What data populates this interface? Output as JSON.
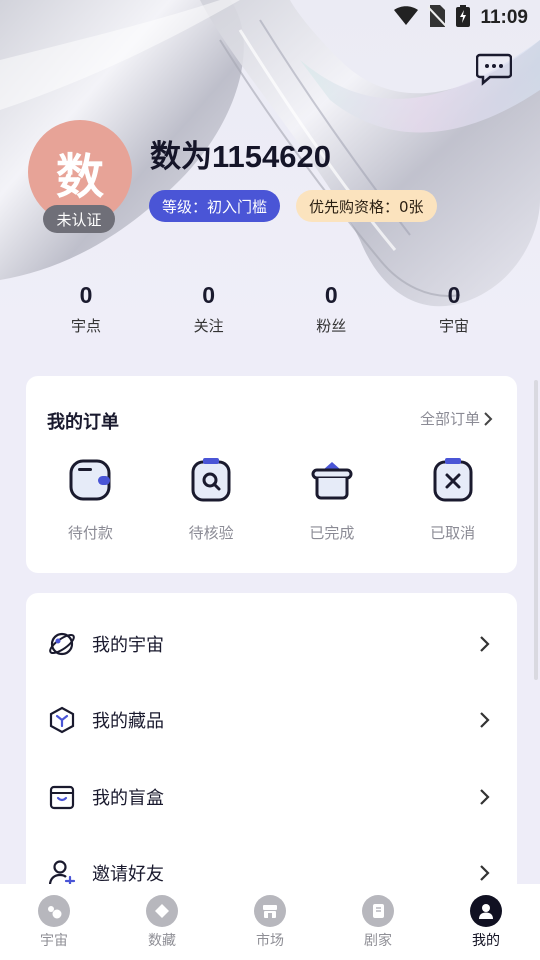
{
  "status_bar": {
    "time": "11:09"
  },
  "profile": {
    "avatar_char": "数",
    "verify_status": "未认证",
    "username": "数为1154620",
    "level_badge": "等级：初入门槛",
    "priority_badge": "优先购资格：0张"
  },
  "stats": [
    {
      "value": "0",
      "label": "宇点"
    },
    {
      "value": "0",
      "label": "关注"
    },
    {
      "value": "0",
      "label": "粉丝"
    },
    {
      "value": "0",
      "label": "宇宙"
    }
  ],
  "orders": {
    "title": "我的订单",
    "all_link": "全部订单",
    "items": [
      {
        "label": "待付款",
        "icon": "wallet-icon"
      },
      {
        "label": "待核验",
        "icon": "clipboard-search-icon"
      },
      {
        "label": "已完成",
        "icon": "basket-icon"
      },
      {
        "label": "已取消",
        "icon": "clipboard-x-icon"
      }
    ]
  },
  "menu": [
    {
      "label": "我的宇宙",
      "icon": "planet-icon"
    },
    {
      "label": "我的藏品",
      "icon": "hexagon-y-icon"
    },
    {
      "label": "我的盲盒",
      "icon": "box-icon"
    },
    {
      "label": "邀请好友",
      "icon": "user-plus-icon"
    }
  ],
  "tabs": [
    {
      "label": "宇宙",
      "active": false
    },
    {
      "label": "数藏",
      "active": false
    },
    {
      "label": "市场",
      "active": false
    },
    {
      "label": "剧家",
      "active": false
    },
    {
      "label": "我的",
      "active": true
    }
  ],
  "colors": {
    "accent": "#4a55d6",
    "priority_bg": "#fbe3be",
    "avatar_bg": "#e7a397",
    "page_bg": "#eeedf8"
  }
}
